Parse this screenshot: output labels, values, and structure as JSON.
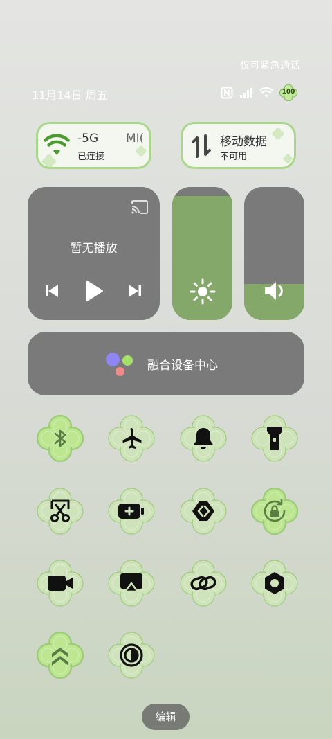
{
  "status_bar": {
    "emergency_text": "仅可紧急通话",
    "date_text": "11月14日 周五",
    "battery_level": "100"
  },
  "quick_pills": {
    "wifi": {
      "name_text": "-5G",
      "name_text_right": "MI(",
      "state_text": "已连接"
    },
    "mobile_data": {
      "name_text": "移动数据",
      "state_text": "不可用"
    }
  },
  "media": {
    "title": "暂无播放"
  },
  "sliders": {
    "brightness_level": 0.93,
    "volume_level": 0.27
  },
  "device_hub": {
    "label": "融合设备中心"
  },
  "toggles": [
    {
      "icon": "bluetooth-icon",
      "active": true
    },
    {
      "icon": "airplane-icon",
      "active": false
    },
    {
      "icon": "bell-icon",
      "active": false
    },
    {
      "icon": "flashlight-icon",
      "active": false
    },
    {
      "icon": "screenshot-scissors-icon",
      "active": false
    },
    {
      "icon": "battery-saver-icon",
      "active": false
    },
    {
      "icon": "nearby-share-icon",
      "active": false
    },
    {
      "icon": "rotation-lock-icon",
      "active": true
    },
    {
      "icon": "screen-record-icon",
      "active": false
    },
    {
      "icon": "screen-cast-icon",
      "active": false
    },
    {
      "icon": "link-icon",
      "active": false
    },
    {
      "icon": "hexagon-settings-icon",
      "active": false
    },
    {
      "icon": "performance-mode-icon",
      "active": true
    },
    {
      "icon": "dark-mode-icon",
      "active": false
    }
  ],
  "edit_button": {
    "label": "编辑"
  },
  "colors": {
    "accent_green": "#83a86a",
    "tile_inactive": "#cfe3bb",
    "tile_active": "#bce690",
    "tile_outline": "#9ccc7a",
    "panel_gray": "#7a7a7a"
  }
}
